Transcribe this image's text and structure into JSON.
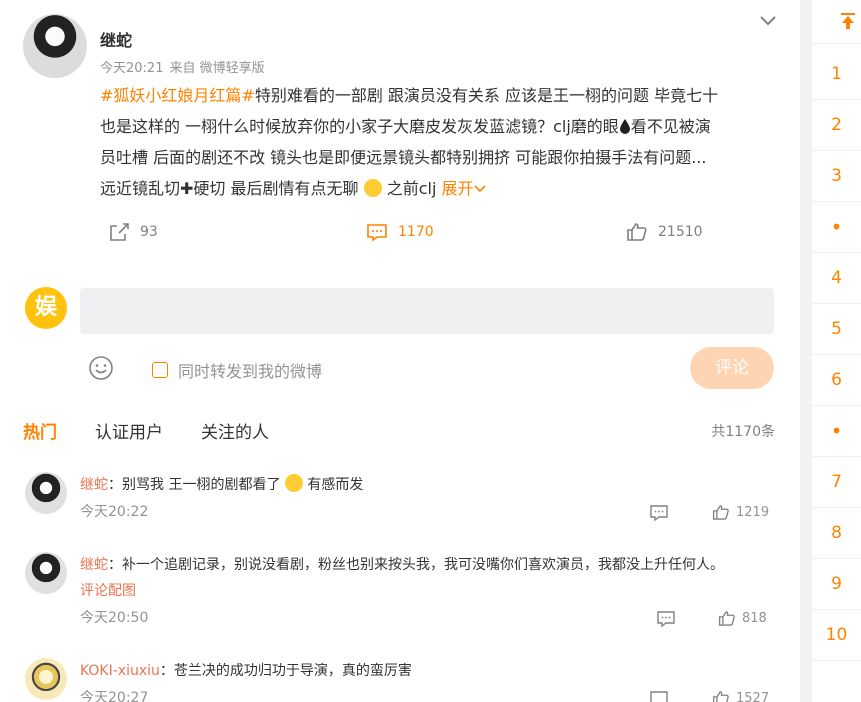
{
  "post": {
    "author": "继蛇",
    "time": "今天20:21",
    "source": "来自 微博轻享版",
    "hashtag": "#狐妖小红娘月红篇#",
    "line1_rest": "特别难看的一部剧 跟演员没有关系 应该是王一栩的问题 毕竟七十",
    "line2": "也是这样的 一栩什么时候放弃你的小家子大磨皮发灰发蓝滤镜？clj磨的眼",
    "line2b": "看不见被演",
    "line3": "员吐槽 后面的剧还不改 镜头也是即便远景镜头都特别拥挤 可能跟你拍摄手法有问题...",
    "line4": "远近镜乱切",
    "line4b": "硬切 最后剧情有点无聊",
    "line4c": "之前clj",
    "expand_label": "展开",
    "reposts": "93",
    "comments": "1170",
    "likes": "21510"
  },
  "composer": {
    "avatar_text": "娱",
    "placeholder": "",
    "forward_label": "同时转发到我的微博",
    "submit_label": "评论"
  },
  "tabs": {
    "hot": "热门",
    "verified": "认证用户",
    "following": "关注的人",
    "total": "共1170条"
  },
  "comments": [
    {
      "user": "继蛇",
      "text": "：别骂我 王一栩的剧都看了",
      "text_after": " 有感而发",
      "sub": "",
      "time": "今天20:22",
      "likes": "1219"
    },
    {
      "user": "继蛇",
      "text": "：补一个追剧记录，别说没看剧，粉丝也别来按头我，我可没嘴你们喜欢演员，我都没上升任何人。",
      "text_after": "",
      "sub": "评论配图",
      "time": "今天20:50",
      "likes": "818"
    },
    {
      "user": "KOKI-xiuxiu",
      "text": "：苍兰决的成功归功于导演，真的蛮厉害",
      "text_after": "",
      "sub": "",
      "time": "今天20:27",
      "likes": "1527"
    }
  ],
  "rail": {
    "items": [
      "1",
      "2",
      "3",
      "•",
      "4",
      "5",
      "6",
      "•",
      "7",
      "8",
      "9",
      "10"
    ]
  },
  "colors": {
    "accent": "#ff8200",
    "username": "#eb7350",
    "muted": "#939393"
  }
}
